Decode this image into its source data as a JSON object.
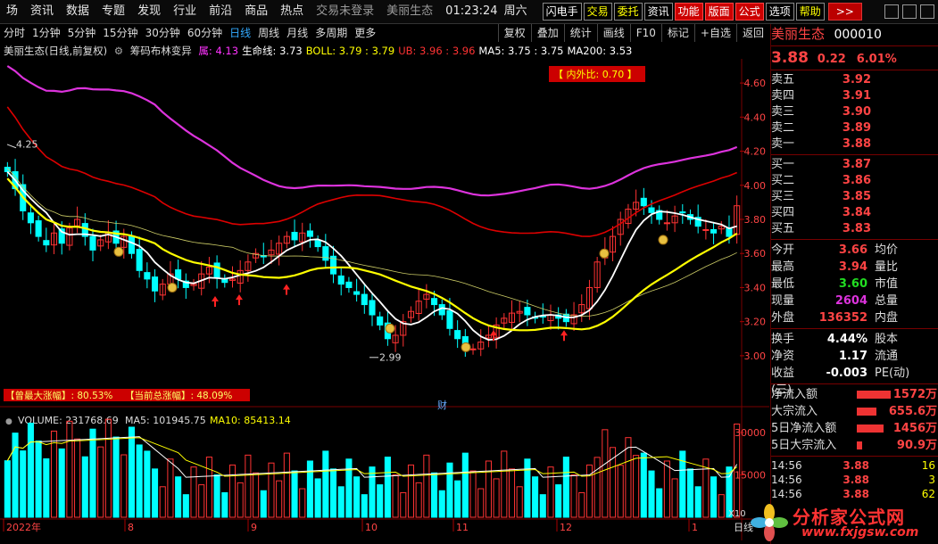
{
  "menubar": {
    "items": [
      "场",
      "资讯",
      "数据",
      "专题",
      "发现",
      "行业",
      "前沿",
      "商品",
      "热点"
    ],
    "login": "交易未登录",
    "stock": "美丽生态",
    "time": "01:23:24",
    "weekday": "周六",
    "buttons": [
      "闪电手",
      "交易",
      "委托",
      "资讯",
      "功能",
      "版面",
      "公式",
      "选项",
      "帮助"
    ],
    "more": ">>"
  },
  "periodbar": {
    "periods": [
      "分时",
      "1分钟",
      "5分钟",
      "15分钟",
      "30分钟",
      "60分钟",
      "日线",
      "周线",
      "月线",
      "多周期",
      "更多"
    ],
    "active_index": 6,
    "tools": [
      "复权",
      "叠加",
      "统计",
      "画线",
      "F10",
      "标记",
      "+自选",
      "返回"
    ]
  },
  "legend": {
    "title": "美丽生态(日线,前复权)",
    "indicator": "筹码布林变异",
    "items": [
      {
        "label": "属: 4.13",
        "color": "#ff33ff"
      },
      {
        "label": "生命线: 3.73",
        "color": "#ffffff"
      },
      {
        "label": "BOLL: 3.79 : 3.79",
        "color": "#ffff00"
      },
      {
        "label": "UB: 3.96 : 3.96",
        "color": "#ff3333"
      },
      {
        "label": "MA5: 3.75 : 3.75",
        "color": "#ffffff"
      },
      {
        "label": "MA200: 3.53",
        "color": "#ffffff"
      }
    ]
  },
  "chart_data": [
    {
      "type": "candlestick",
      "title": "美丽生态(日线,前复权)",
      "ylim": [
        2.9,
        4.7
      ],
      "yticks": [
        "4.60",
        "4.40",
        "4.20",
        "4.00",
        "3.80",
        "3.60",
        "3.40",
        "3.20",
        "3.00"
      ],
      "annotations": [
        "4.25",
        "2.99",
        "内外比: 0.70",
        "曾最大涨幅: 80.53%",
        "当前总涨幅: 48.09%",
        "买",
        "财"
      ],
      "close": [
        4.08,
        3.98,
        3.85,
        3.78,
        3.7,
        3.65,
        3.72,
        3.66,
        3.75,
        3.8,
        3.7,
        3.62,
        3.68,
        3.72,
        3.66,
        3.7,
        3.6,
        3.5,
        3.45,
        3.38,
        3.42,
        3.48,
        3.45,
        3.4,
        3.42,
        3.48,
        3.52,
        3.46,
        3.43,
        3.45,
        3.5,
        3.55,
        3.6,
        3.58,
        3.62,
        3.66,
        3.7,
        3.68,
        3.72,
        3.7,
        3.64,
        3.56,
        3.48,
        3.42,
        3.4,
        3.36,
        3.3,
        3.24,
        3.18,
        3.1,
        3.12,
        3.2,
        3.26,
        3.32,
        3.36,
        3.3,
        3.24,
        3.16,
        3.1,
        3.06,
        3.04,
        3.08,
        3.12,
        3.18,
        3.22,
        3.25,
        3.26,
        3.24,
        3.22,
        3.23,
        3.24,
        3.22,
        3.2,
        3.24,
        3.3,
        3.4,
        3.55,
        3.62,
        3.7,
        3.8,
        3.86,
        3.9,
        3.88,
        3.84,
        3.8,
        3.78,
        3.82,
        3.84,
        3.8,
        3.76,
        3.74,
        3.72,
        3.76,
        3.7,
        3.88
      ],
      "volume_series": [
        {
          "name": "VOLUME",
          "value": "231768.69"
        },
        {
          "name": "MA5",
          "value": "101945.75"
        },
        {
          "name": "MA10",
          "value": "85413.14"
        }
      ],
      "volume_yticks": [
        "30000",
        "15000"
      ],
      "x_ticks": [
        "2022年",
        "8",
        "9",
        "10",
        "11",
        "12",
        "1"
      ]
    }
  ],
  "volume_legend": {
    "vol": "VOLUME: 231768.69",
    "ma5": "MA5: 101945.75",
    "ma10": "MA10: 85413.14"
  },
  "badges": {
    "ratio": "【 内外比: 0.70 】",
    "max_gain": "【曾最大涨幅】: 80.53%",
    "cur_gain": "【当前总涨幅】: 48.09%",
    "hi": "4.25",
    "lo": "2.99",
    "cai": "财",
    "x10": "X10",
    "day": "日线"
  },
  "info": {
    "name": "美丽生态",
    "code": "000010",
    "price": "3.88",
    "change": "0.22",
    "pct": "6.01%",
    "asks": [
      {
        "k": "卖五",
        "v": "3.92"
      },
      {
        "k": "卖四",
        "v": "3.91"
      },
      {
        "k": "卖三",
        "v": "3.90"
      },
      {
        "k": "卖二",
        "v": "3.89"
      },
      {
        "k": "卖一",
        "v": "3.88"
      }
    ],
    "bids": [
      {
        "k": "买一",
        "v": "3.87"
      },
      {
        "k": "买二",
        "v": "3.86"
      },
      {
        "k": "买三",
        "v": "3.85"
      },
      {
        "k": "买四",
        "v": "3.84"
      },
      {
        "k": "买五",
        "v": "3.83"
      }
    ],
    "stats": [
      {
        "a": "今开",
        "b": "3.66",
        "c": "均价",
        "bc": "#ff4444"
      },
      {
        "a": "最高",
        "b": "3.94",
        "c": "量比",
        "bc": "#ff4444"
      },
      {
        "a": "最低",
        "b": "3.60",
        "c": "市值",
        "bc": "#22dd22"
      },
      {
        "a": "现量",
        "b": "2604",
        "c": "总量",
        "bc": "#dd33dd"
      },
      {
        "a": "外盘",
        "b": "136352",
        "c": "内盘",
        "bc": "#ff4444"
      }
    ],
    "stats2": [
      {
        "a": "换手",
        "b": "4.44%",
        "c": "股本",
        "bc": "#ffffff"
      },
      {
        "a": "净资",
        "b": "1.17",
        "c": "流通",
        "bc": "#ffffff"
      },
      {
        "a": "收益(三)",
        "b": "-0.003",
        "c": "PE(动)",
        "bc": "#ffffff"
      }
    ],
    "flows": [
      {
        "a": "净流入额",
        "b": "1572万",
        "w": 38
      },
      {
        "a": "大宗流入",
        "b": "655.6万",
        "w": 22
      },
      {
        "a": "5日净流入额",
        "b": "1456万",
        "w": 30
      },
      {
        "a": "5日大宗流入",
        "b": "90.9万",
        "w": 6
      }
    ],
    "ticks": [
      {
        "t": "14:56",
        "p": "3.88",
        "q": "16"
      },
      {
        "t": "14:56",
        "p": "3.88",
        "q": "3"
      },
      {
        "t": "14:56",
        "p": "3.88",
        "q": "62"
      }
    ]
  },
  "watermark": {
    "line1": "分析家公式网",
    "line2": "www.fxjgsw.com"
  },
  "colors": {
    "up": "#ff3333",
    "down": "#00ffff",
    "ub": "#dd0000",
    "mid": "#ffff00",
    "lifeline": "#ffffff",
    "shu": "#dd33dd",
    "bg": "#000000"
  }
}
